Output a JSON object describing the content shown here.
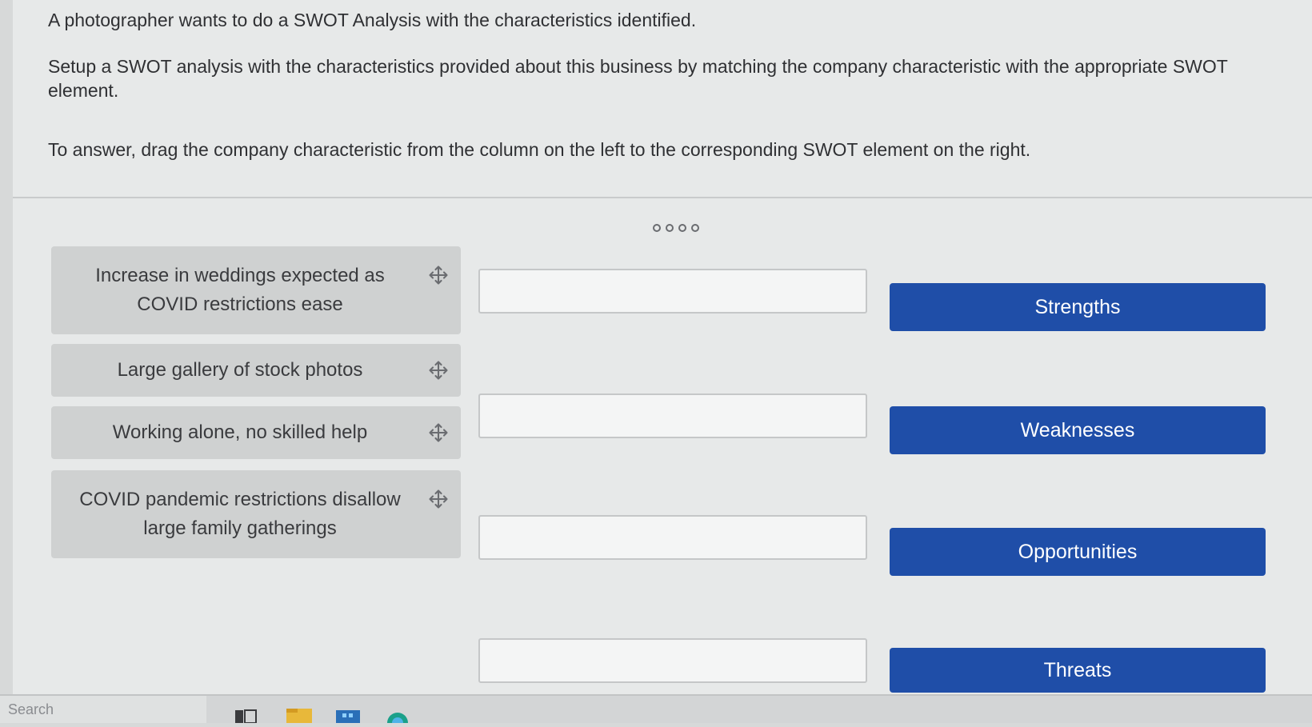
{
  "instructions": {
    "line1": "A photographer wants to do a SWOT Analysis with the characteristics identified.",
    "line2": "Setup a SWOT analysis with the characteristics provided about this business by matching the company characteristic with the appropriate SWOT element.",
    "line3": "To answer, drag the company characteristic from the column on the left to the corresponding SWOT element on the right."
  },
  "characteristics": [
    {
      "label": "Increase in weddings expected as COVID restrictions ease"
    },
    {
      "label": "Large gallery of stock photos"
    },
    {
      "label": "Working alone, no skilled help"
    },
    {
      "label": "COVID pandemic restrictions disallow large family gatherings"
    }
  ],
  "swot_elements": [
    {
      "label": "Strengths"
    },
    {
      "label": "Weaknesses"
    },
    {
      "label": "Opportunities"
    },
    {
      "label": "Threats"
    }
  ],
  "icons": {
    "move": "move-arrows-icon",
    "pager": "pager-dot-icon"
  },
  "colors": {
    "swot_button": "#1f4ea8",
    "chip_bg": "#cfd1d1",
    "page_bg": "#e7e9e9"
  },
  "taskbar": {
    "search_placeholder": "Search"
  }
}
